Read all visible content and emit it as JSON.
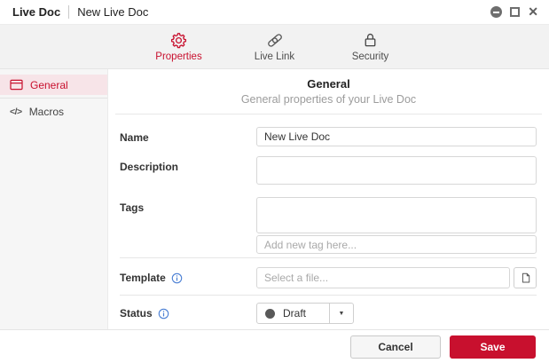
{
  "titlebar": {
    "app_title": "Live Doc",
    "doc_title": "New Live Doc",
    "close_glyph": "✕"
  },
  "tabs": [
    {
      "label": "Properties",
      "icon": "gear-icon",
      "active": true
    },
    {
      "label": "Live Link",
      "icon": "link-icon",
      "active": false
    },
    {
      "label": "Security",
      "icon": "lock-icon",
      "active": false
    }
  ],
  "sidebar": {
    "items": [
      {
        "label": "General",
        "icon": "window-icon",
        "active": true
      },
      {
        "label": "Macros",
        "icon": "code-icon",
        "icon_glyph": "</>",
        "active": false
      }
    ]
  },
  "header": {
    "title": "General",
    "subtitle": "General properties of your Live Doc"
  },
  "form": {
    "name": {
      "label": "Name",
      "value": "New Live Doc"
    },
    "description": {
      "label": "Description",
      "value": ""
    },
    "tags": {
      "label": "Tags",
      "add_placeholder": "Add new tag here..."
    },
    "template": {
      "label": "Template",
      "placeholder": "Select a file...",
      "value": ""
    },
    "status": {
      "label": "Status",
      "value": "Draft"
    },
    "dropdown_arrow_glyph": "▼"
  },
  "footer": {
    "cancel_label": "Cancel",
    "save_label": "Save"
  },
  "colors": {
    "accent": "#C8102E",
    "accent_soft_bg": "#F7E4E8",
    "info_blue": "#4A7FD4",
    "status_dot": "#595959",
    "tabbar_bg": "#F2F2F2",
    "sidebar_bg": "#F6F6F6"
  }
}
